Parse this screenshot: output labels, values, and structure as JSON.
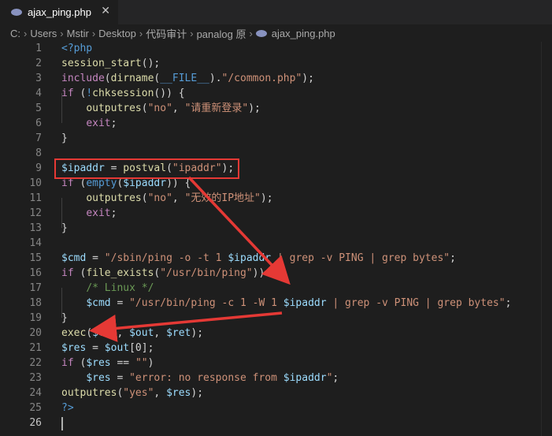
{
  "tab": {
    "filename": "ajax_ping.php",
    "close_symbol": "✕",
    "php_icon": "php-elephant-icon"
  },
  "breadcrumb": [
    "C:",
    "Users",
    "Mstir",
    "Desktop",
    "代码审计",
    "panalog 原",
    "ajax_ping.php"
  ],
  "breadcrumb_separator": "›",
  "highlight_color": "#e53935",
  "cursor_line": 26,
  "lines": [
    [
      [
        "tag",
        "<?php"
      ]
    ],
    [
      [
        "fn",
        "session_start"
      ],
      [
        "pl",
        "();"
      ]
    ],
    [
      [
        "kw",
        "include"
      ],
      [
        "pl",
        "("
      ],
      [
        "fn",
        "dirname"
      ],
      [
        "pl",
        "("
      ],
      [
        "kw2",
        "__FILE__"
      ],
      [
        "pl",
        ")."
      ],
      [
        "str",
        "\"/common.php\""
      ],
      [
        "pl",
        ");"
      ]
    ],
    [
      [
        "kw",
        "if"
      ],
      [
        "pl",
        " ("
      ],
      [
        "kw2",
        "!"
      ],
      [
        "fn",
        "chksession"
      ],
      [
        "pl",
        "()) {"
      ]
    ],
    [
      [
        "pl",
        "    "
      ],
      [
        "fn",
        "outputres"
      ],
      [
        "pl",
        "("
      ],
      [
        "str",
        "\"no\""
      ],
      [
        "pl",
        ", "
      ],
      [
        "str",
        "\"请重新登录\""
      ],
      [
        "pl",
        ");"
      ]
    ],
    [
      [
        "pl",
        "    "
      ],
      [
        "kw",
        "exit"
      ],
      [
        "pl",
        ";"
      ]
    ],
    [
      [
        "pl",
        "}"
      ]
    ],
    [],
    [
      [
        "var",
        "$ipaddr"
      ],
      [
        "pl",
        " = "
      ],
      [
        "fn",
        "postval"
      ],
      [
        "pl",
        "("
      ],
      [
        "str",
        "\"ipaddr\""
      ],
      [
        "pl",
        ");"
      ]
    ],
    [
      [
        "kw",
        "if"
      ],
      [
        "pl",
        " ("
      ],
      [
        "kw2",
        "empty"
      ],
      [
        "pl",
        "("
      ],
      [
        "var",
        "$ipaddr"
      ],
      [
        "pl",
        ")) {"
      ]
    ],
    [
      [
        "pl",
        "    "
      ],
      [
        "fn",
        "outputres"
      ],
      [
        "pl",
        "("
      ],
      [
        "str",
        "\"no\""
      ],
      [
        "pl",
        ", "
      ],
      [
        "str",
        "\"无效的IP地址\""
      ],
      [
        "pl",
        ");"
      ]
    ],
    [
      [
        "pl",
        "    "
      ],
      [
        "kw",
        "exit"
      ],
      [
        "pl",
        ";"
      ]
    ],
    [
      [
        "pl",
        "}"
      ]
    ],
    [],
    [
      [
        "var",
        "$cmd"
      ],
      [
        "pl",
        " = "
      ],
      [
        "str",
        "\"/sbin/ping -o -t 1 "
      ],
      [
        "var",
        "$ipaddr"
      ],
      [
        "str",
        " | grep -v PING | grep bytes\""
      ],
      [
        "pl",
        ";"
      ]
    ],
    [
      [
        "kw",
        "if"
      ],
      [
        "pl",
        " ("
      ],
      [
        "fn",
        "file_exists"
      ],
      [
        "pl",
        "("
      ],
      [
        "str",
        "\"/usr/bin/ping\""
      ],
      [
        "pl",
        ")) {"
      ]
    ],
    [
      [
        "pl",
        "    "
      ],
      [
        "com",
        "/* Linux */"
      ]
    ],
    [
      [
        "pl",
        "    "
      ],
      [
        "var",
        "$cmd"
      ],
      [
        "pl",
        " = "
      ],
      [
        "str",
        "\"/usr/bin/ping -c 1 -W 1 "
      ],
      [
        "var",
        "$ipaddr"
      ],
      [
        "str",
        " | grep -v PING | grep bytes\""
      ],
      [
        "pl",
        ";"
      ]
    ],
    [
      [
        "pl",
        "}"
      ]
    ],
    [
      [
        "fn",
        "exec"
      ],
      [
        "pl",
        "("
      ],
      [
        "var",
        "$cmd"
      ],
      [
        "pl",
        ", "
      ],
      [
        "var",
        "$out"
      ],
      [
        "pl",
        ", "
      ],
      [
        "var",
        "$ret"
      ],
      [
        "pl",
        ");"
      ]
    ],
    [
      [
        "var",
        "$res"
      ],
      [
        "pl",
        " = "
      ],
      [
        "var",
        "$out"
      ],
      [
        "pl",
        "[0];"
      ]
    ],
    [
      [
        "kw",
        "if"
      ],
      [
        "pl",
        " ("
      ],
      [
        "var",
        "$res"
      ],
      [
        "pl",
        " == "
      ],
      [
        "str",
        "\"\""
      ],
      [
        "pl",
        ")"
      ]
    ],
    [
      [
        "pl",
        "    "
      ],
      [
        "var",
        "$res"
      ],
      [
        "pl",
        " = "
      ],
      [
        "str",
        "\"error: no response from "
      ],
      [
        "var",
        "$ipaddr"
      ],
      [
        "str",
        "\""
      ],
      [
        "pl",
        ";"
      ]
    ],
    [
      [
        "fn",
        "outputres"
      ],
      [
        "pl",
        "("
      ],
      [
        "str",
        "\"yes\""
      ],
      [
        "pl",
        ", "
      ],
      [
        "var",
        "$res"
      ],
      [
        "pl",
        ");"
      ]
    ],
    [
      [
        "tag",
        "?>"
      ]
    ],
    []
  ]
}
